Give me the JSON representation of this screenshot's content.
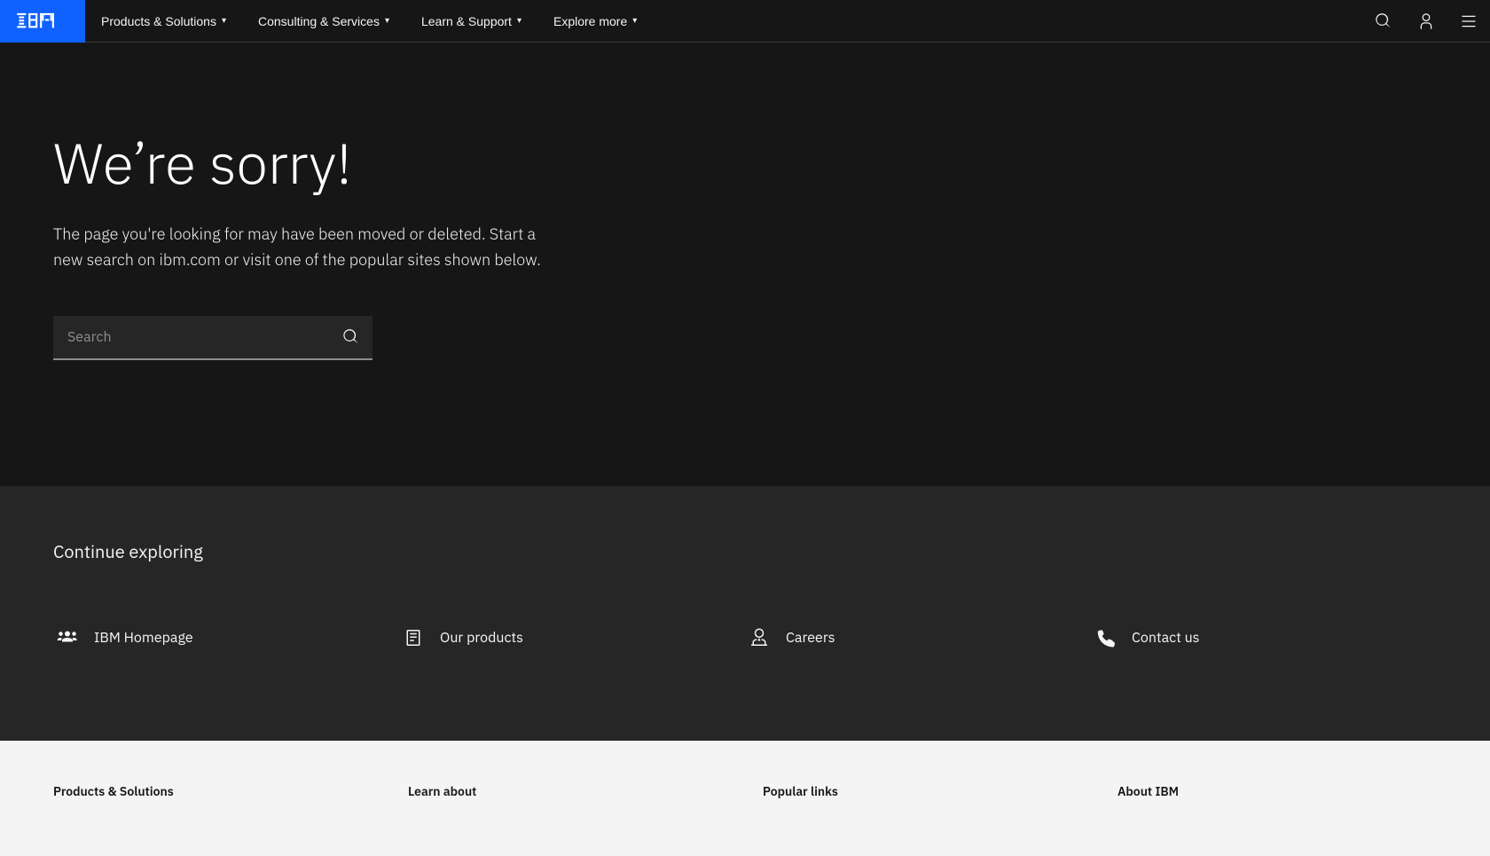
{
  "nav": {
    "logo_alt": "IBM",
    "links": [
      {
        "label": "Products & Solutions",
        "id": "products-solutions"
      },
      {
        "label": "Consulting & Services",
        "id": "consulting-services"
      },
      {
        "label": "Learn & Support",
        "id": "learn-support"
      },
      {
        "label": "Explore more",
        "id": "explore-more"
      }
    ],
    "search_label": "Search",
    "user_label": "User",
    "menu_label": "Menu"
  },
  "hero": {
    "heading": "We’re sorry!",
    "body": "The page you're looking for may have been moved or deleted. Start a new search on ibm.com or visit one of the popular sites shown below.",
    "search_placeholder": "Search"
  },
  "explore": {
    "heading": "Continue exploring",
    "items": [
      {
        "id": "ibm-homepage",
        "label": "IBM Homepage",
        "icon": "homepage-icon"
      },
      {
        "id": "our-products",
        "label": "Our products",
        "icon": "products-icon"
      },
      {
        "id": "careers",
        "label": "Careers",
        "icon": "careers-icon"
      },
      {
        "id": "contact-us",
        "label": "Contact us",
        "icon": "phone-icon"
      }
    ]
  },
  "footer": {
    "columns": [
      {
        "id": "products-solutions-col",
        "heading": "Products & Solutions",
        "links": []
      },
      {
        "id": "learn-about-col",
        "heading": "Learn about",
        "links": []
      },
      {
        "id": "popular-links-col",
        "heading": "Popular links",
        "links": []
      },
      {
        "id": "about-ibm-col",
        "heading": "About IBM",
        "links": []
      }
    ]
  }
}
